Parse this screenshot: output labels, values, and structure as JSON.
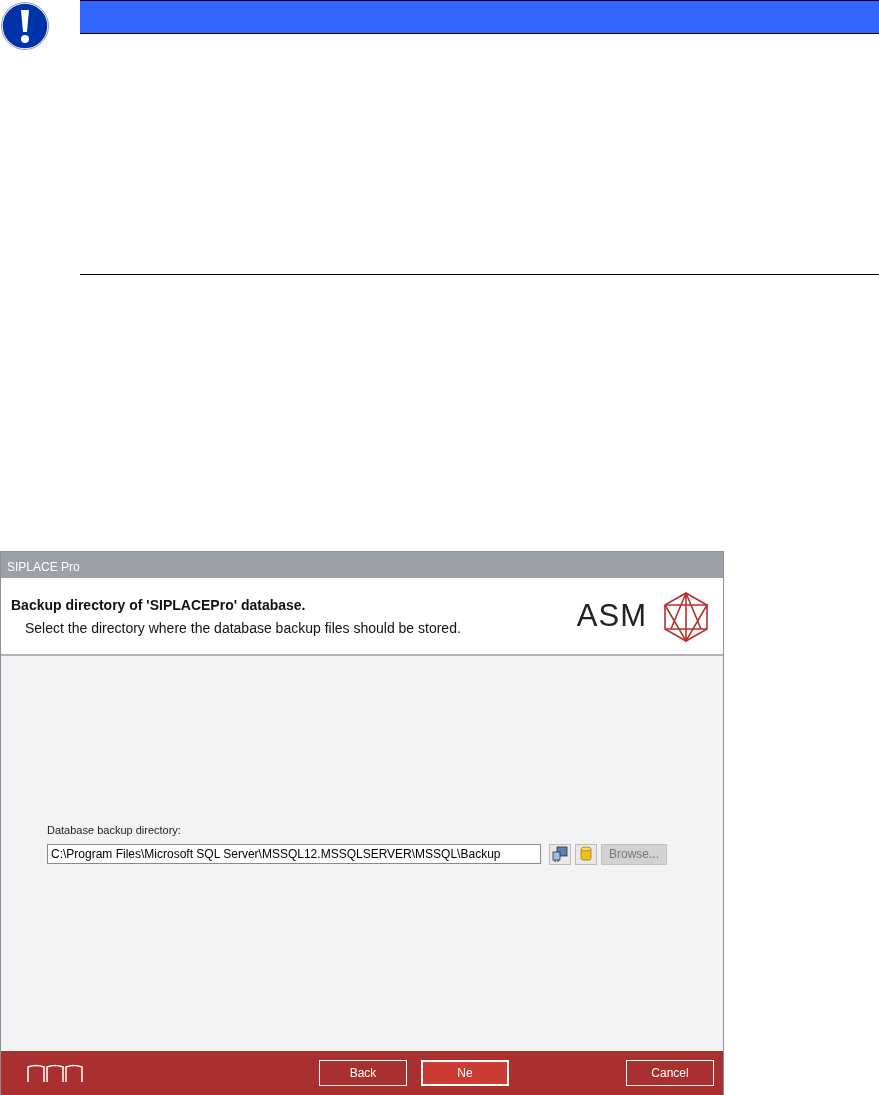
{
  "notice": {
    "kind": "warning"
  },
  "window": {
    "title": "SIPLACE Pro"
  },
  "header": {
    "title": "Backup directory of 'SIPLACEPro' database.",
    "subtitle": "Select the directory where the database backup files should be stored.",
    "logo_text": "ASM"
  },
  "field": {
    "label": "Database backup directory:",
    "value": "C:\\Program Files\\Microsoft SQL Server\\MSSQL12.MSSQLSERVER\\MSSQL\\Backup"
  },
  "browse_button": {
    "label": "Browse...",
    "disabled": true
  },
  "footer_buttons": [
    {
      "label": "Back",
      "selected": false
    },
    {
      "label": "Ne",
      "selected": true
    },
    {
      "label": "Cancel",
      "selected": false
    }
  ]
}
